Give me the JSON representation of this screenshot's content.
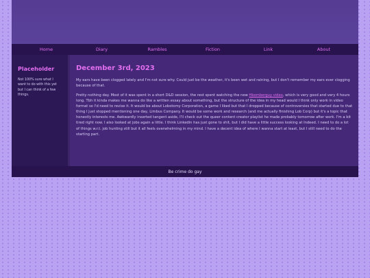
{
  "nav": {
    "items": [
      "Home",
      "Diary",
      "Rambles",
      "Fiction",
      "Link",
      "About"
    ]
  },
  "sidebar": {
    "title": "Placeholder",
    "text": "Not 100% sure what I want to do with this yet but I can think of a few things."
  },
  "post": {
    "date": "December 3rd, 2023",
    "p1": "My ears have been clogged lately and I'm not sure why. Could just be the weather, it's been wet and raining, but I don't remember my ears ever clogging because of that.",
    "p2_before": "Pretty nothing day. Most of it was spent in a short D&D session, the rest spent watching the new ",
    "p2_link": "Hbomberguy video",
    "p2_after": ", which is very good and very 4 hours long. Tbh it kinda makes me wanna do like a written essay about something, but the structure of the idea in my head would I think only work in video format so I'd need to revise it. It would be about Lobotomy Corporation, a game I liked but that I dropped because of controversies that started due to that thing I just stopped mentioning one day, Limbus Company. It would be some work and research (and me actually finishing Lob Corp) but it's a topic that honestly interests me. Awkwardly inserted tangent aside, I'll check out the queer content creator playlist he made probably tomorrow after work. I'm a bit tired right now. I also looked at jobs again a little. I think Linkedin has just gone to shit, but I did have a little success looking at Indeed. I need to do a lot of things w.r.t. job hunting still but it all feels overwhelming in my mind. I have a decent idea of where I wanna start at least, but I still need to do the starting part."
  },
  "footer": {
    "text": "Be crime do gay"
  }
}
